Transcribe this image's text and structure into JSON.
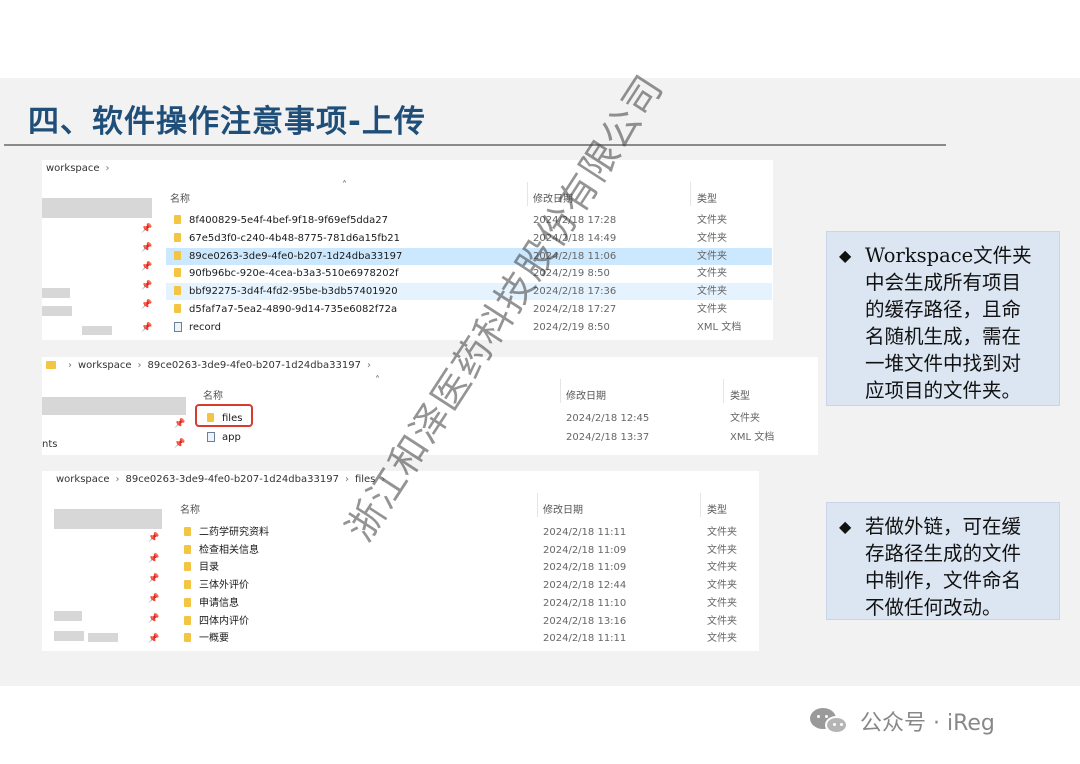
{
  "slide": {
    "title": "四、软件操作注意事项-上传",
    "watermark": "浙江和泽医药科技股份有限公司",
    "footer": {
      "brand": "公众号 · iReg"
    }
  },
  "panel1": {
    "breadcrumb": [
      "workspace"
    ],
    "columns": {
      "name": "名称",
      "date": "修改日期",
      "type": "类型"
    },
    "rows": [
      {
        "name": "8f400829-5e4f-4bef-9f18-9f69ef5dda27",
        "date": "2024/2/18 17:28",
        "type": "文件夹",
        "icon": "folder-icon"
      },
      {
        "name": "67e5d3f0-c240-4b48-8775-781d6a15fb21",
        "date": "2024/2/18 14:49",
        "type": "文件夹",
        "icon": "folder-icon"
      },
      {
        "name": "89ce0263-3de9-4fe0-b207-1d24dba33197",
        "date": "2024/2/18 11:06",
        "type": "文件夹",
        "icon": "folder-icon",
        "state": "selected"
      },
      {
        "name": "90fb96bc-920e-4cea-b3a3-510e6978202f",
        "date": "2024/2/19 8:50",
        "type": "文件夹",
        "icon": "folder-icon"
      },
      {
        "name": "bbf92275-3d4f-4fd2-95be-b3db57401920",
        "date": "2024/2/18 17:36",
        "type": "文件夹",
        "icon": "folder-icon",
        "state": "hover"
      },
      {
        "name": "d5faf7a7-5ea2-4890-9d14-735e6082f72a",
        "date": "2024/2/18 17:27",
        "type": "文件夹",
        "icon": "folder-icon"
      },
      {
        "name": "record",
        "date": "2024/2/19 8:50",
        "type": "XML 文档",
        "icon": "xml-file-icon"
      }
    ]
  },
  "panel2": {
    "breadcrumb": [
      "workspace",
      "89ce0263-3de9-4fe0-b207-1d24dba33197"
    ],
    "sidebar_fragment": "nts",
    "columns": {
      "name": "名称",
      "date": "修改日期",
      "type": "类型"
    },
    "rows": [
      {
        "name": "files",
        "date": "2024/2/18 12:45",
        "type": "文件夹",
        "icon": "folder-icon",
        "highlighted": true
      },
      {
        "name": "app",
        "date": "2024/2/18 13:37",
        "type": "XML 文档",
        "icon": "xml-file-icon"
      }
    ]
  },
  "panel3": {
    "breadcrumb": [
      "workspace",
      "89ce0263-3de9-4fe0-b207-1d24dba33197",
      "files"
    ],
    "columns": {
      "name": "名称",
      "date": "修改日期",
      "type": "类型"
    },
    "rows": [
      {
        "name": "二药学研究资料",
        "date": "2024/2/18 11:11",
        "type": "文件夹",
        "icon": "folder-icon"
      },
      {
        "name": "检查相关信息",
        "date": "2024/2/18 11:09",
        "type": "文件夹",
        "icon": "folder-icon"
      },
      {
        "name": "目录",
        "date": "2024/2/18 11:09",
        "type": "文件夹",
        "icon": "folder-icon"
      },
      {
        "name": "三体外评价",
        "date": "2024/2/18 12:44",
        "type": "文件夹",
        "icon": "folder-icon"
      },
      {
        "name": "申请信息",
        "date": "2024/2/18 11:10",
        "type": "文件夹",
        "icon": "folder-icon"
      },
      {
        "name": "四体内评价",
        "date": "2024/2/18 13:16",
        "type": "文件夹",
        "icon": "folder-icon"
      },
      {
        "name": "一概要",
        "date": "2024/2/18 11:11",
        "type": "文件夹",
        "icon": "folder-icon"
      }
    ]
  },
  "callouts": [
    {
      "bullet": "◆",
      "lines": [
        "Workspace文件夹",
        "中会生成所有项目",
        "的缓存路径，且命",
        "名随机生成，需在",
        "一堆文件中找到对",
        "应项目的文件夹。"
      ]
    },
    {
      "bullet": "◆",
      "lines": [
        "若做外链，可在缓",
        "存路径生成的文件",
        "中制作，文件命名",
        "不做任何改动。"
      ]
    }
  ]
}
